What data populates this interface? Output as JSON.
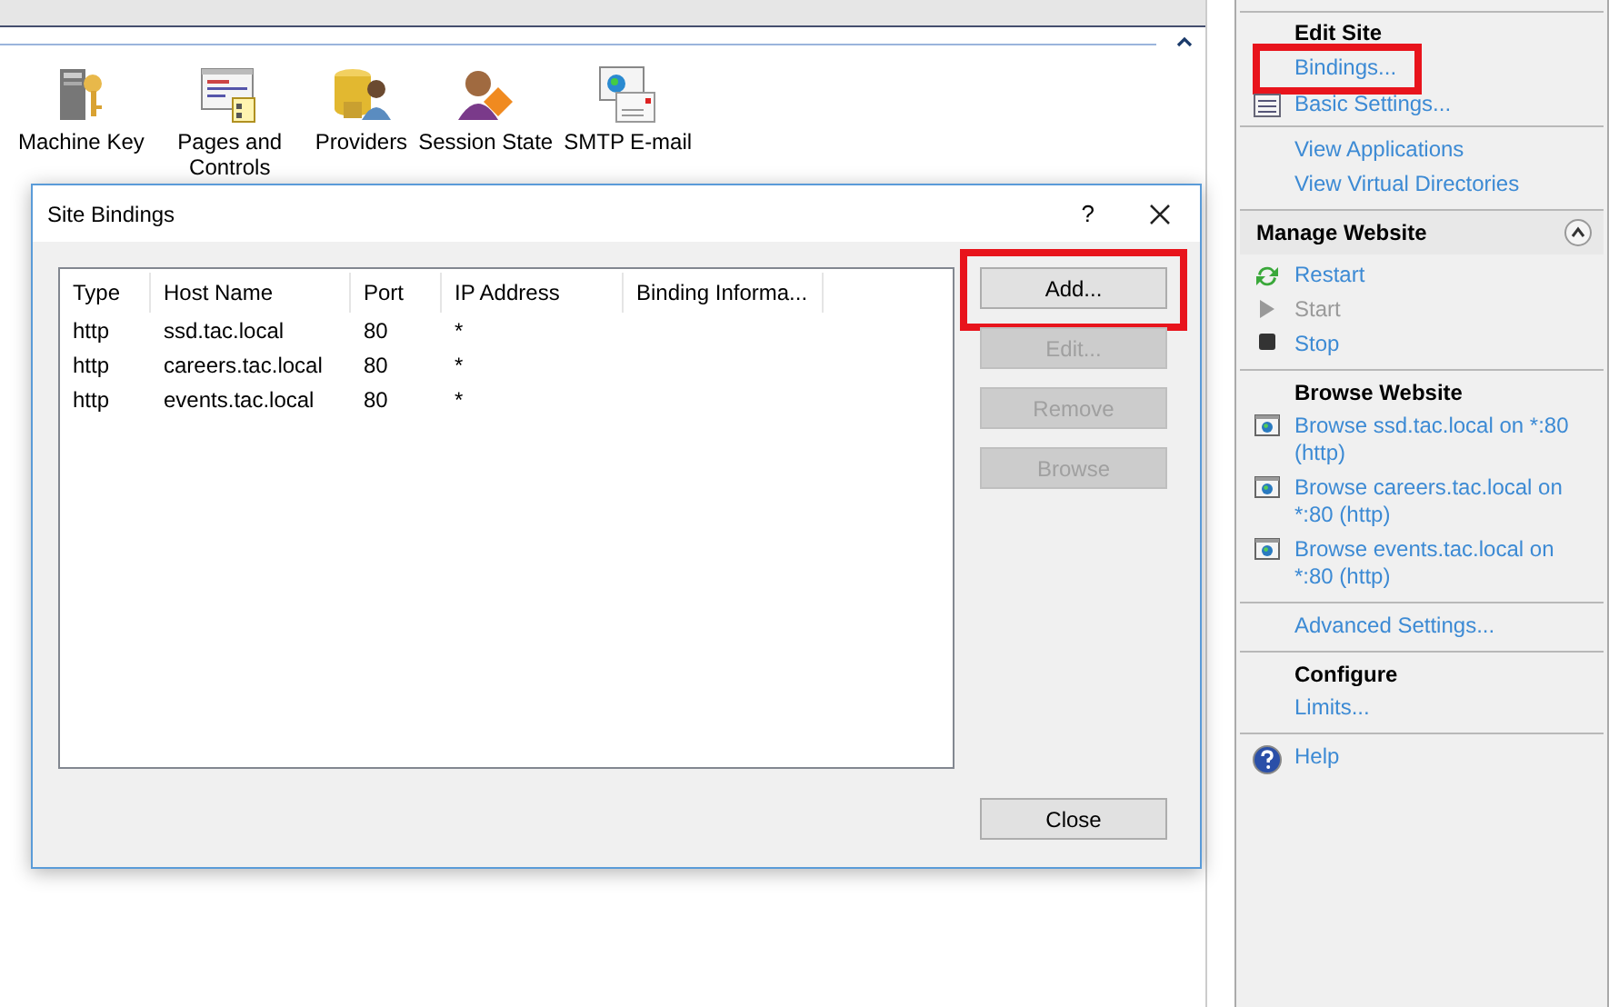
{
  "features": [
    {
      "label": "Machine Key",
      "kind": "key-server"
    },
    {
      "label": "Pages and Controls",
      "kind": "pages"
    },
    {
      "label": "Providers",
      "kind": "providers"
    },
    {
      "label": "Session State",
      "kind": "session"
    },
    {
      "label": "SMTP E-mail",
      "kind": "mail"
    }
  ],
  "dialog": {
    "title": "Site Bindings",
    "help_glyph": "?",
    "columns": [
      "Type",
      "Host Name",
      "Port",
      "IP Address",
      "Binding Informa..."
    ],
    "rows": [
      [
        "http",
        "ssd.tac.local",
        "80",
        "*"
      ],
      [
        "http",
        "careers.tac.local",
        "80",
        "*"
      ],
      [
        "http",
        "events.tac.local",
        "80",
        "*"
      ]
    ],
    "buttons": [
      {
        "label": "Add...",
        "disabled": false,
        "highlighted": true
      },
      {
        "label": "Edit...",
        "disabled": true,
        "highlighted": false
      },
      {
        "label": "Remove",
        "disabled": true,
        "highlighted": false
      },
      {
        "label": "Browse",
        "disabled": true,
        "highlighted": false
      }
    ],
    "close_button": "Close"
  },
  "actions": [
    {
      "heading": "Edit Site",
      "kind": "plain",
      "items": [
        {
          "label": "Bindings...",
          "kind": "link",
          "disabled": false,
          "highlighted": true
        },
        {
          "label": "Basic Settings...",
          "kind": "document",
          "disabled": false,
          "highlighted": false
        }
      ]
    },
    {
      "items": [
        {
          "label": "View Applications",
          "kind": "link",
          "disabled": false,
          "highlighted": false
        },
        {
          "label": "View Virtual Directories",
          "kind": "link",
          "disabled": false,
          "highlighted": false
        }
      ]
    },
    {
      "heading": "Manage Website",
      "kind": "panel",
      "expanded": true,
      "items": [
        {
          "label": "Restart",
          "kind": "restart",
          "disabled": false,
          "highlighted": false
        },
        {
          "label": "Start",
          "kind": "play",
          "disabled": true,
          "highlighted": false
        },
        {
          "label": "Stop",
          "kind": "stop",
          "disabled": false,
          "highlighted": false
        }
      ]
    },
    {
      "heading": "Browse Website",
      "kind": "plain",
      "items": [
        {
          "label": "Browse ssd.tac.local on *:80 (http)",
          "kind": "browse",
          "disabled": false,
          "highlighted": false
        },
        {
          "label": "Browse careers.tac.local on *:80 (http)",
          "kind": "browse",
          "disabled": false,
          "highlighted": false
        },
        {
          "label": "Browse events.tac.local on *:80 (http)",
          "kind": "browse",
          "disabled": false,
          "highlighted": false
        }
      ]
    },
    {
      "items": [
        {
          "label": "Advanced Settings...",
          "kind": "link",
          "disabled": false,
          "highlighted": false
        }
      ]
    },
    {
      "heading": "Configure",
      "kind": "plain",
      "items": [
        {
          "label": "Limits...",
          "kind": "link",
          "disabled": false,
          "highlighted": false
        }
      ]
    },
    {
      "items": [
        {
          "label": "Help",
          "kind": "help",
          "disabled": false,
          "highlighted": false
        }
      ]
    }
  ]
}
